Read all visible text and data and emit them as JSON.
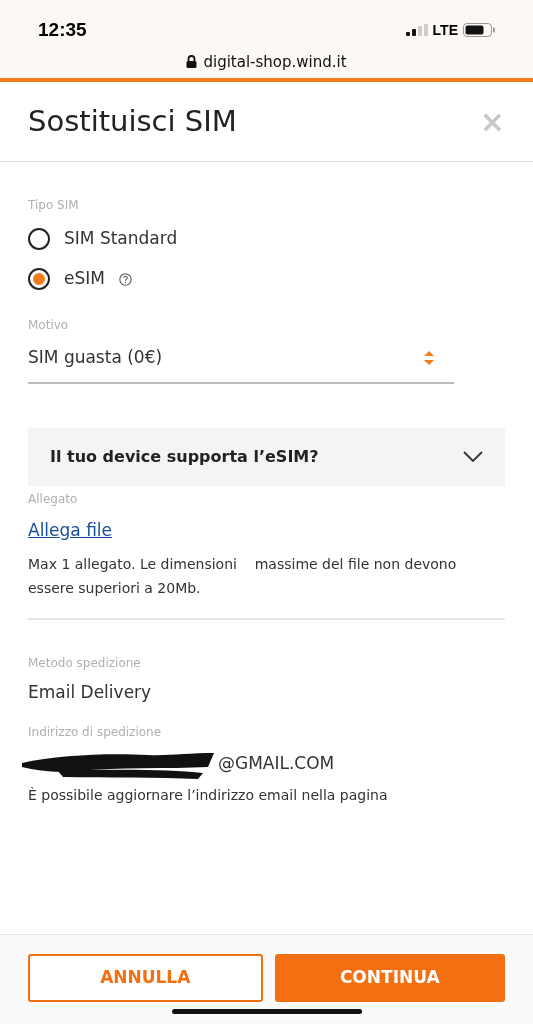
{
  "status_bar": {
    "time": "12:35",
    "network": "LTE"
  },
  "browser": {
    "url": "digital-shop.wind.it"
  },
  "modal": {
    "title": "Sostituisci SIM",
    "close": "×"
  },
  "sim_type": {
    "label": "Tipo SIM",
    "options": [
      {
        "label": "SIM Standard",
        "selected": false,
        "help": false
      },
      {
        "label": "eSIM",
        "selected": true,
        "help": true
      }
    ]
  },
  "reason": {
    "label": "Motivo",
    "value": "SIM guasta (0€)"
  },
  "accordion": {
    "title": "Il tuo device supporta l’eSIM?",
    "expanded": false
  },
  "attachment": {
    "label": "Allegato",
    "link": "Allega file",
    "note": "Max 1 allegato. Le dimensioni    massime del file non devono essere superiori a 20Mb."
  },
  "shipping_method": {
    "label": "Metodo spedizione",
    "value": "Email Delivery"
  },
  "shipping_address": {
    "label": "Indirizzo di spedizione",
    "value": "@GMAIL.COM",
    "redacted": true,
    "note": "È possibile aggiornare l’indirizzo email nella pagina"
  },
  "buttons": [
    {
      "label": "ANNULLA",
      "kind": "outline"
    },
    {
      "label": "CONTINUA",
      "kind": "filled"
    }
  ]
}
